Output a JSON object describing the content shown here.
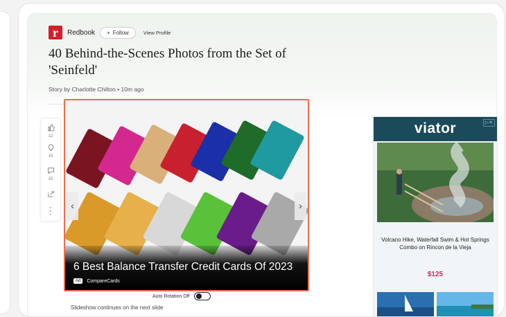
{
  "publisher": {
    "logo_letter": "r",
    "name": "Redbook",
    "follow_label": "Follow",
    "view_profile_label": "View Profile"
  },
  "article": {
    "title": "40 Behind-the-Scenes Photos from the Set of 'Seinfeld'",
    "byline": "Story by Charlotte Chilton • 10m ago"
  },
  "actions": [
    {
      "icon": "thumbs-up-icon",
      "count": "12"
    },
    {
      "icon": "lightbulb-icon",
      "count": "15"
    },
    {
      "icon": "comment-icon",
      "count": "15"
    },
    {
      "icon": "share-icon",
      "count": ""
    },
    {
      "icon": "more-icon",
      "count": ""
    }
  ],
  "slideshow": {
    "title": "6 Best Balance Transfer Credit Cards Of 2023",
    "ad_badge": "Ad",
    "source": "CompareCards",
    "auto_rotation_label": "Auto Rotation Off",
    "continues_text": "Slideshow continues on the next slide"
  },
  "side_ad": {
    "brand": "viator",
    "tour_name": "Volcano Hike, Waterfall Swim & Hot Springs Combo on Rincon de la Vieja",
    "price": "$125"
  },
  "colors": {
    "highlight": "#f26b4b",
    "brand_red": "#d21f2b",
    "viator_bar": "#1b4a5b",
    "price": "#c03060"
  }
}
